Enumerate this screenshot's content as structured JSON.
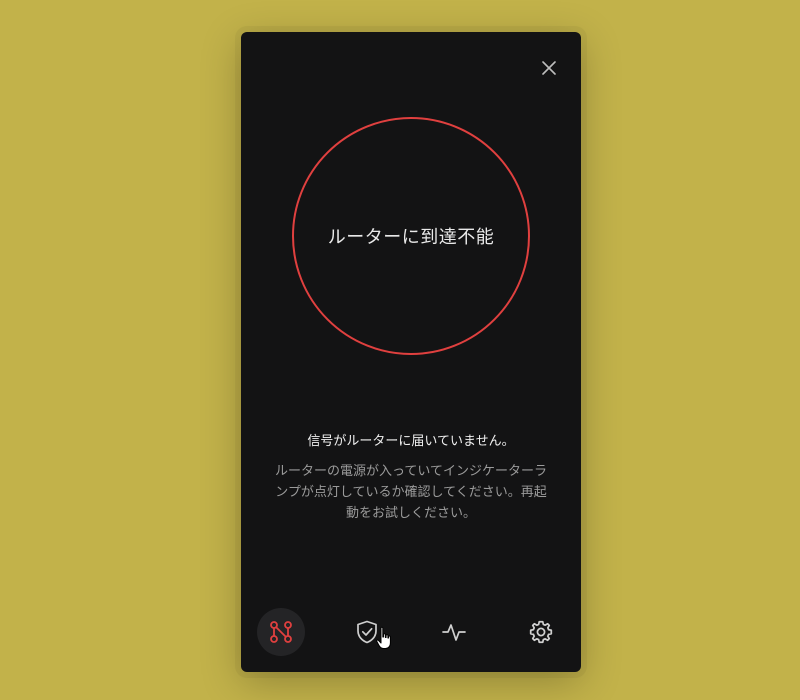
{
  "status": {
    "ring_label": "ルーターに到達不能",
    "ring_color": "#e0403f"
  },
  "message": {
    "headline": "信号がルーターに届いていません。",
    "detail": "ルーターの電源が入っていてインジケーターランプが点灯しているか確認してください。再起動をお試しください。"
  },
  "nav": {
    "items": [
      {
        "icon": "network-nodes-icon",
        "active": true
      },
      {
        "icon": "shield-check-icon",
        "active": false
      },
      {
        "icon": "activity-pulse-icon",
        "active": false
      },
      {
        "icon": "gear-icon",
        "active": false
      }
    ]
  },
  "colors": {
    "background": "#c2b24a",
    "panel": "#131314",
    "accent_red": "#e0403f"
  }
}
